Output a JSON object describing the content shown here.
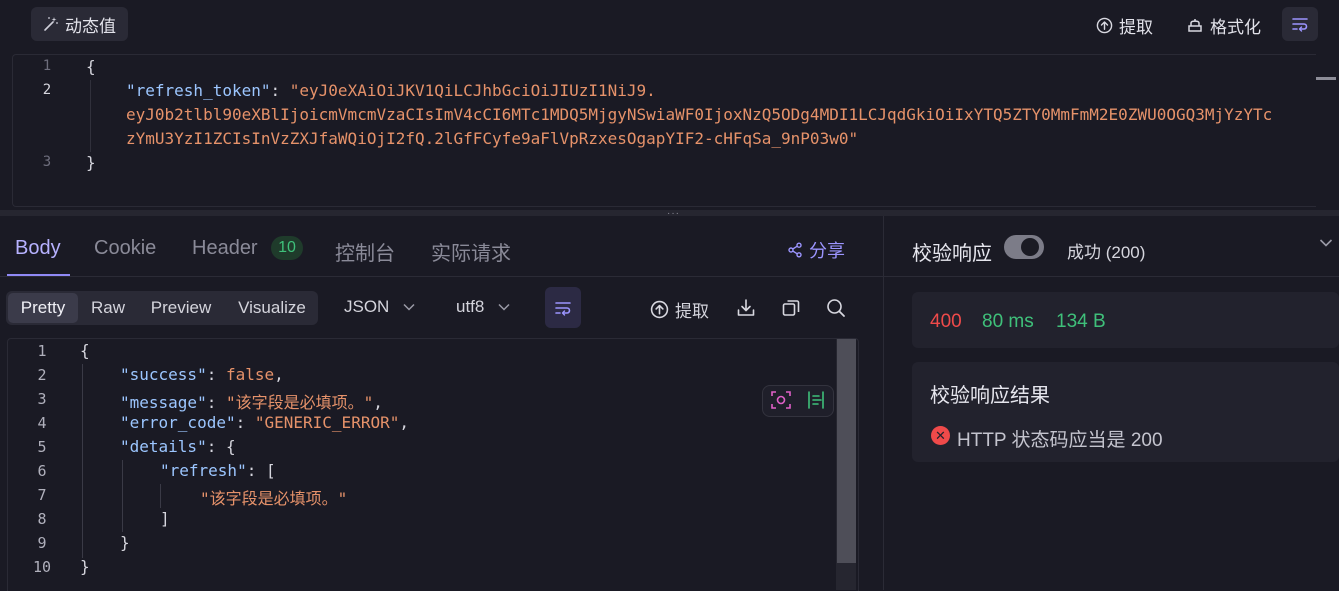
{
  "request": {
    "dynamic_value_label": "动态值",
    "extract_label": "提取",
    "format_label": "格式化",
    "lines": [
      {
        "num": "1",
        "text": "{"
      },
      {
        "num": "2",
        "key": "\"refresh_token\"",
        "sep": ": ",
        "value_part1": "\"eyJ0eXAiOiJKV1QiLCJhbGciOiJIUzI1NiJ9.",
        "value_part2": "eyJ0b2tlbl90eXBlIjoicmVmcmVzaCIsImV4cCI6MTc1MDQ5MjgyNSwiaWF0IjoxNzQ5ODg4MDI1LCJqdGkiOiIxYTQ5ZTY0MmFmM2E0ZWU0OGQ3MjYzYTc",
        "value_part3": "zYmU3YzI1ZCIsInVzZXJfaWQiOjI2fQ.2lGfFCyfe9aFlVpRzxesOgapYIF2-cHFqSa_9nP03w0\""
      },
      {
        "num": "3",
        "text": "}"
      }
    ]
  },
  "response": {
    "tabs": {
      "body": "Body",
      "cookie": "Cookie",
      "header": "Header",
      "header_count": "10",
      "console": "控制台",
      "actual_request": "实际请求"
    },
    "share_label": "分享",
    "view_modes": {
      "pretty": "Pretty",
      "raw": "Raw",
      "preview": "Preview",
      "visualize": "Visualize"
    },
    "format_select": "JSON",
    "encoding_select": "utf8",
    "extract_label": "提取",
    "line_numbers": [
      "1",
      "2",
      "3",
      "4",
      "5",
      "6",
      "7",
      "8",
      "9",
      "10"
    ],
    "code": {
      "l1": "{",
      "success_key": "\"success\"",
      "success_val": "false",
      "message_key": "\"message\"",
      "message_val": "\"该字段是必填项。\"",
      "error_key": "\"error_code\"",
      "error_val": "\"GENERIC_ERROR\"",
      "details_key": "\"details\"",
      "details_open": ": {",
      "refresh_key": "\"refresh\"",
      "refresh_open": ": [",
      "refresh_item": "\"该字段是必填项。\"",
      "arr_close": "]",
      "obj_close": "}",
      "root_close": "}"
    }
  },
  "validation": {
    "title": "校验响应",
    "enabled": true,
    "status_label": "成功 (200)",
    "metrics": {
      "status_code": "400",
      "time": "80 ms",
      "size": "134 B"
    },
    "result_title": "校验响应结果",
    "result_message": "HTTP 状态码应当是 200"
  }
}
